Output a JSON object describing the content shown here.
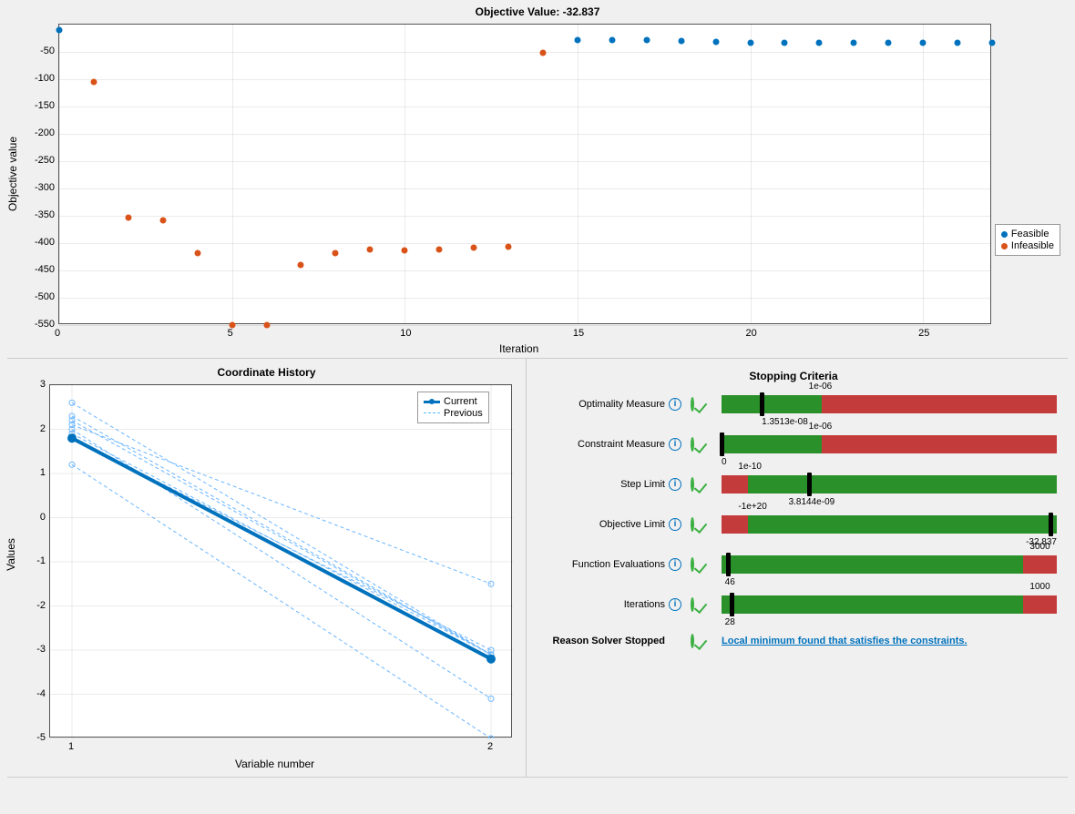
{
  "chart_data": [
    {
      "type": "scatter",
      "title": "Objective Value: -32.837",
      "xlabel": "Iteration",
      "ylabel": "Objective value",
      "xlim": [
        0,
        27
      ],
      "ylim": [
        -550,
        0
      ],
      "series": [
        {
          "name": "Feasible",
          "color": "#0072bd",
          "x": [
            0,
            15,
            16,
            17,
            18,
            19,
            20,
            21,
            22,
            23,
            24,
            25,
            26,
            27
          ],
          "y": [
            -10,
            -29,
            -28,
            -28,
            -30,
            -32,
            -33,
            -33,
            -34,
            -33,
            -33,
            -33,
            -33,
            -33
          ]
        },
        {
          "name": "Infeasible",
          "color": "#d95319",
          "x": [
            1,
            2,
            3,
            4,
            5,
            6,
            7,
            8,
            9,
            10,
            11,
            12,
            13,
            14
          ],
          "y": [
            -105,
            -353,
            -358,
            -418,
            -550,
            -550,
            -440,
            -418,
            -412,
            -413,
            -411,
            -409,
            -407,
            -52
          ]
        }
      ],
      "legend": [
        "Feasible",
        "Infeasible"
      ]
    },
    {
      "type": "line",
      "title": "Coordinate History",
      "xlabel": "Variable number",
      "ylabel": "Values",
      "xlim": [
        1,
        2
      ],
      "ylim": [
        -5,
        3
      ],
      "series": [
        {
          "name": "Current",
          "style": "solid",
          "x": [
            1,
            2
          ],
          "y": [
            1.8,
            -3.2
          ]
        },
        {
          "name": "Previous",
          "style": "dashed",
          "lines": [
            [
              [
                1,
                2.6
              ],
              [
                2,
                -3.1
              ]
            ],
            [
              [
                1,
                2.3
              ],
              [
                2,
                -3.1
              ]
            ],
            [
              [
                1,
                2.2
              ],
              [
                2,
                -3.1
              ]
            ],
            [
              [
                1,
                2.1
              ],
              [
                2,
                -1.5
              ]
            ],
            [
              [
                1,
                2.0
              ],
              [
                2,
                -4.1
              ]
            ],
            [
              [
                1,
                1.9
              ],
              [
                2,
                -3.1
              ]
            ],
            [
              [
                1,
                1.2
              ],
              [
                2,
                -5.0
              ]
            ],
            [
              [
                1,
                1.8
              ],
              [
                2,
                -3.0
              ]
            ]
          ]
        }
      ],
      "legend": [
        "Current",
        "Previous"
      ]
    }
  ],
  "top": {
    "title": "Objective Value: -32.837",
    "xlabel": "Iteration",
    "ylabel": "Objective value",
    "legend_feasible": "Feasible",
    "legend_infeasible": "Infeasible",
    "yticks": [
      "-50",
      "-100",
      "-150",
      "-200",
      "-250",
      "-300",
      "-350",
      "-400",
      "-450",
      "-500",
      "-550"
    ],
    "xticks": [
      "0",
      "5",
      "10",
      "15",
      "20",
      "25"
    ]
  },
  "coord": {
    "title": "Coordinate History",
    "xlabel": "Variable number",
    "ylabel": "Values",
    "legend_current": "Current",
    "legend_previous": "Previous",
    "yticks": [
      "3",
      "2",
      "1",
      "0",
      "-1",
      "-2",
      "-3",
      "-4",
      "-5"
    ],
    "xticks": [
      "1",
      "2"
    ]
  },
  "stopping": {
    "title": "Stopping Criteria",
    "rows": [
      {
        "label": "Optimality Measure",
        "threshold": "1e-06",
        "value": "1.3513e-08",
        "green_left": 0,
        "green_width": 30,
        "marker": 12
      },
      {
        "label": "Constraint Measure",
        "threshold": "1e-06",
        "value": "0",
        "green_left": 0,
        "green_width": 30,
        "marker": 0
      },
      {
        "label": "Step Limit",
        "threshold": "1e-10",
        "value": "3.8144e-09",
        "green_left": 8,
        "green_width": 92,
        "marker": 26
      },
      {
        "label": "Objective Limit",
        "threshold": "-1e+20",
        "value": "-32.837",
        "green_left": 8,
        "green_width": 92,
        "marker": 98
      },
      {
        "label": "Function Evaluations",
        "threshold": "3000",
        "value": "46",
        "green_left": 0,
        "green_width": 90,
        "marker": 2
      },
      {
        "label": "Iterations",
        "threshold": "1000",
        "value": "28",
        "green_left": 0,
        "green_width": 90,
        "marker": 3
      }
    ],
    "reason_label": "Reason Solver Stopped",
    "reason_text": "Local minimum found that satisfies the constraints."
  }
}
